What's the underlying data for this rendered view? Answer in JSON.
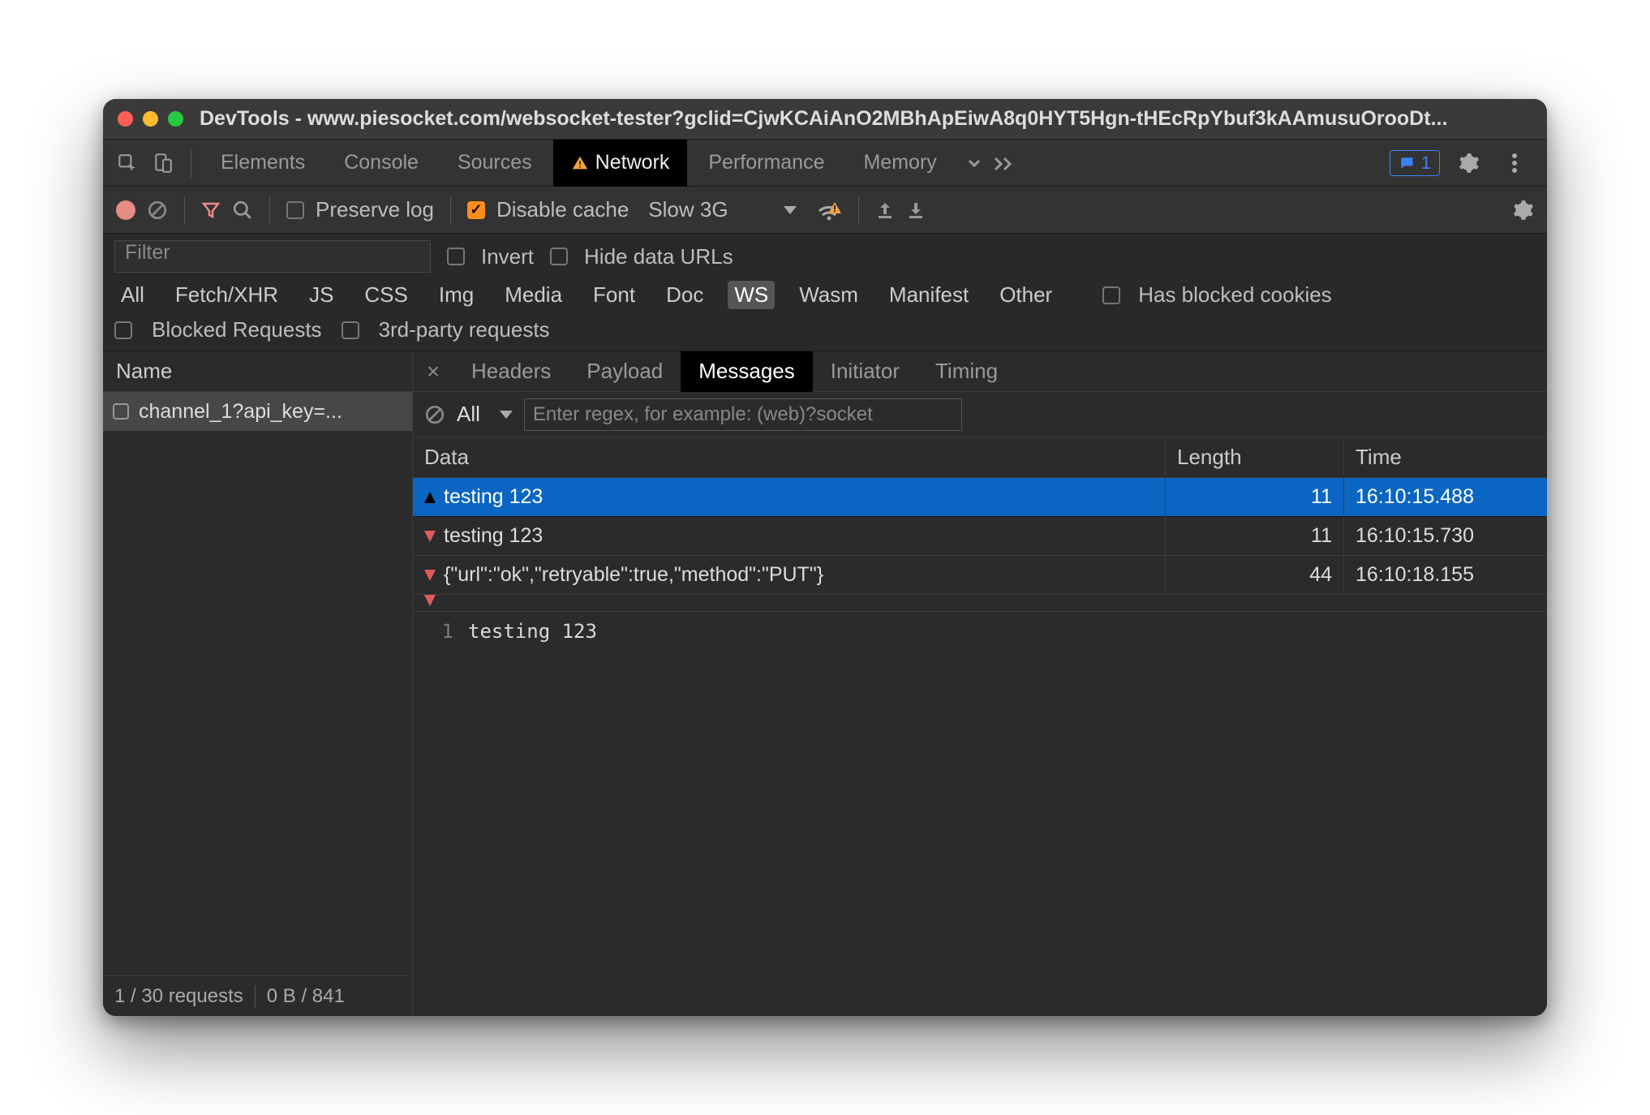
{
  "window": {
    "title": "DevTools - www.piesocket.com/websocket-tester?gclid=CjwKCAiAnO2MBhApEiwA8q0HYT5Hgn-tHEcRpYbuf3kAAmusuOrooDt..."
  },
  "mainTabs": {
    "items": [
      "Elements",
      "Console",
      "Sources",
      "Network",
      "Performance",
      "Memory"
    ],
    "active": "Network",
    "issueCount": "1"
  },
  "netToolbar": {
    "preserve_label": "Preserve log",
    "disable_cache_label": "Disable cache",
    "throttle_value": "Slow 3G"
  },
  "filterBar": {
    "filter_placeholder": "Filter",
    "invert_label": "Invert",
    "hide_label": "Hide data URLs",
    "types": [
      "All",
      "Fetch/XHR",
      "JS",
      "CSS",
      "Img",
      "Media",
      "Font",
      "Doc",
      "WS",
      "Wasm",
      "Manifest",
      "Other"
    ],
    "type_selected": "WS",
    "blocked_cookies_label": "Has blocked cookies",
    "blocked_req_label": "Blocked Requests",
    "third_party_label": "3rd-party requests"
  },
  "requests": {
    "header": "Name",
    "items": [
      {
        "name": "channel_1?api_key=..."
      }
    ],
    "footer_left": "1 / 30 requests",
    "footer_right": "0 B / 841"
  },
  "detailTabs": {
    "items": [
      "Headers",
      "Payload",
      "Messages",
      "Initiator",
      "Timing"
    ],
    "active": "Messages"
  },
  "messagesToolbar": {
    "scope": "All",
    "regex_placeholder": "Enter regex, for example: (web)?socket"
  },
  "messagesTable": {
    "headers": {
      "data": "Data",
      "length": "Length",
      "time": "Time"
    },
    "rows": [
      {
        "dir": "up",
        "data": "testing 123",
        "length": "11",
        "time": "16:10:15.488",
        "selected": true
      },
      {
        "dir": "down",
        "data": "testing 123",
        "length": "11",
        "time": "16:10:15.730",
        "selected": false
      },
      {
        "dir": "down",
        "data": "{\"url\":\"ok\",\"retryable\":true,\"method\":\"PUT\"}",
        "length": "44",
        "time": "16:10:18.155",
        "selected": false
      }
    ]
  },
  "messageDetail": {
    "line_no": "1",
    "content": "testing 123"
  }
}
